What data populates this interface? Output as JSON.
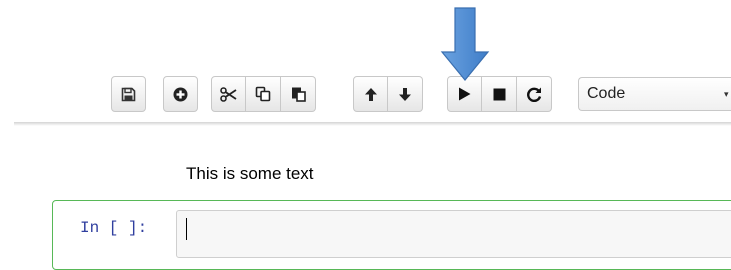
{
  "toolbar": {
    "buttons": {
      "save": {
        "icon": "floppy-disk-icon"
      },
      "insert_cell": {
        "icon": "plus-circle-icon"
      },
      "cut": {
        "icon": "scissors-icon"
      },
      "copy": {
        "icon": "copy-icon"
      },
      "paste": {
        "icon": "paste-icon"
      },
      "move_up": {
        "icon": "arrow-up-icon"
      },
      "move_down": {
        "icon": "arrow-down-icon"
      },
      "run": {
        "icon": "play-icon"
      },
      "interrupt": {
        "icon": "stop-icon"
      },
      "restart": {
        "icon": "refresh-icon"
      }
    },
    "cell_type": {
      "selected": "Code"
    }
  },
  "annotation": {
    "arrow_color": "#5b93d3",
    "points_to": "run"
  },
  "notebook": {
    "text_cell": "This is some text",
    "code_cell": {
      "prompt": "In [ ]:",
      "input_value": "",
      "border_color": "#57b857"
    }
  }
}
